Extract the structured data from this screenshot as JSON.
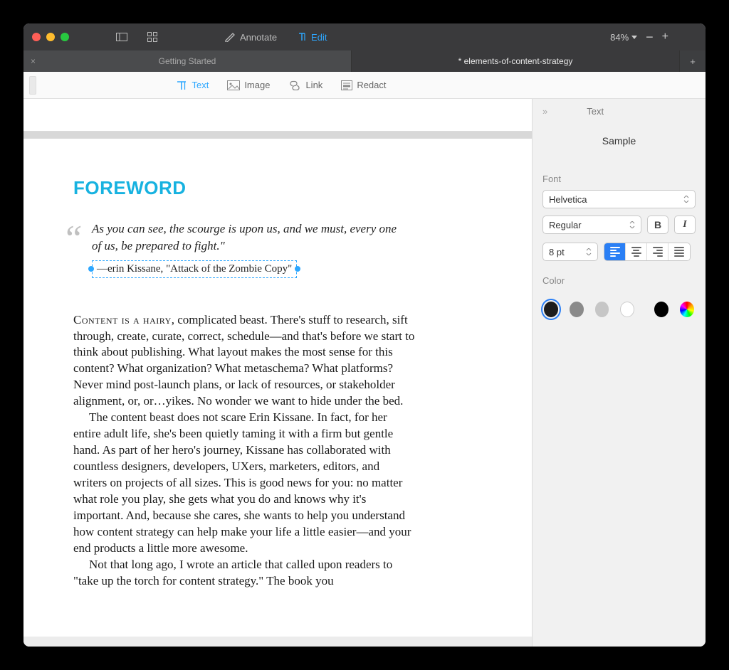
{
  "titlebar": {
    "annotate_label": "Annotate",
    "edit_label": "Edit",
    "zoom_pct": "84%",
    "minus": "−",
    "plus": "+"
  },
  "tabs": {
    "inactive_label": "Getting Started",
    "active_label": "* elements-of-content-strategy",
    "close_glyph": "×",
    "new_glyph": "+"
  },
  "edit_toolbar": {
    "text": "Text",
    "image": "Image",
    "link": "Link",
    "redact": "Redact"
  },
  "document": {
    "title": "FOREWORD",
    "quote": "As you can see, the scourge is upon us, and we must, every one of us, be prepared to fight.\"",
    "attribution_dash": "—",
    "attribution_author": "erin Kissane,",
    "attribution_work": "\"Attack of the Zombie Copy\"",
    "para1_lead": "Content is a hairy",
    "para1_rest": ", complicated beast. There's stuff to research, sift through, create, curate, correct, schedule—and that's before we start to think about publishing. What layout makes the most sense for this content? What organization? What metaschema? What platforms? Never mind post-launch plans, or lack of resources, or stakeholder alignment, or, or…yikes. No wonder we want to hide under the bed.",
    "para2": "The content beast does not scare Erin Kissane. In fact, for her entire adult life, she's been quietly taming it with a firm but gentle hand. As part of her hero's journey, Kissane has collaborated with countless designers, developers, UXers, marketers, editors, and writers on projects of all sizes. This is good news for you: no matter what role you play, she gets what you do and knows why it's important. And, because she cares, she wants to help you understand how content strategy can help make your life a little easier—and your end products a little more awesome.",
    "para3": "Not that long ago, I wrote an article that called upon readers to \"take up the torch for content strategy.\" The book you"
  },
  "inspector": {
    "panel_label": "Text",
    "collapse_glyph": "»",
    "sample_label": "Sample",
    "font_label": "Font",
    "font_family": "Helvetica",
    "font_weight": "Regular",
    "bold_glyph": "B",
    "italic_glyph": "I",
    "font_size": "8 pt",
    "color_label": "Color",
    "colors": {
      "c1": "#1d1d1d",
      "c2": "#8a8a8a",
      "c3": "#c6c6c6",
      "c4": "#ffffff",
      "c5": "#000000"
    }
  }
}
